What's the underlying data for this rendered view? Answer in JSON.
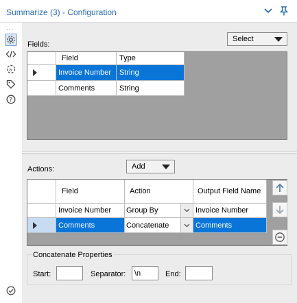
{
  "window": {
    "title": "Summarize (3) - Configuration",
    "collapse_icon": "chevron-down-icon",
    "pin_icon": "pin-icon"
  },
  "left_toolbar": {
    "more": "...",
    "items": [
      {
        "icon": "gear-icon"
      },
      {
        "icon": "code-icon"
      },
      {
        "icon": "rename-icon"
      },
      {
        "icon": "tag-icon"
      },
      {
        "icon": "help-icon"
      }
    ],
    "status_icon": "check-circle-icon"
  },
  "fields": {
    "label": "Fields:",
    "select_dropdown": "Select",
    "columns": [
      "Field",
      "Type"
    ],
    "rows": [
      {
        "field": "Invoice Number",
        "type": "String",
        "selected": true
      },
      {
        "field": "Comments",
        "type": "String",
        "selected": false
      }
    ]
  },
  "actions": {
    "label": "Actions:",
    "add_dropdown": "Add",
    "columns": [
      "Field",
      "Action",
      "Output Field Name"
    ],
    "rows": [
      {
        "field": "Invoice Number",
        "action": "Group By",
        "output": "Invoice Number",
        "selected": false
      },
      {
        "field": "Comments",
        "action": "Concatenate",
        "output": "Comments",
        "selected": true
      }
    ],
    "buttons": {
      "up": "arrow-up-icon",
      "down": "arrow-down-icon",
      "remove": "minus-circle-icon"
    }
  },
  "concatenate": {
    "title": "Concatenate Properties",
    "start_label": "Start:",
    "start_value": "",
    "separator_label": "Separator:",
    "separator_value": "\\n",
    "end_label": "End:",
    "end_value": ""
  },
  "colors": {
    "title": "#2e6fb8",
    "selection": "#0a75d8",
    "row_selector": "#c7dcf2",
    "panel": "#ececec",
    "grid_empty": "#a0a0a0"
  }
}
